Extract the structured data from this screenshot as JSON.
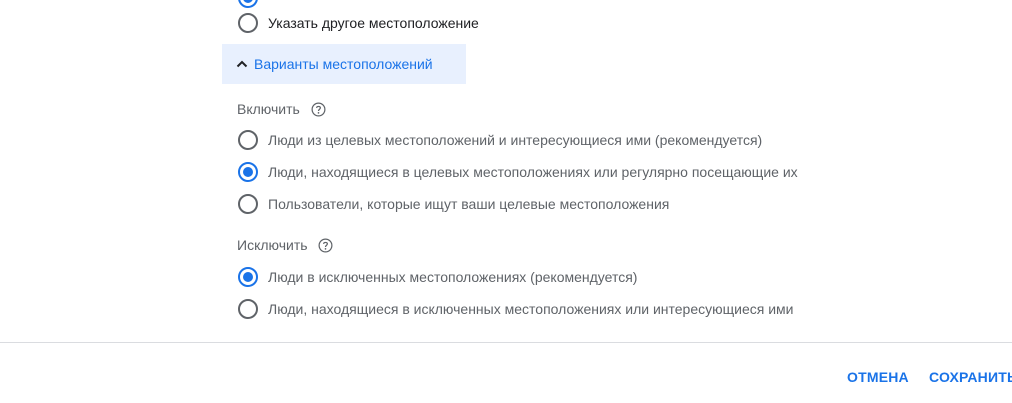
{
  "location_options": {
    "other_location_label": "Указать другое местоположение"
  },
  "panel": {
    "toggle_label": "Варианты местоположений",
    "toggle_icon": "chevron-up-icon"
  },
  "include": {
    "title": "Включить",
    "help_icon": "help-icon",
    "options": [
      {
        "label": "Люди из целевых местоположений и интересующиеся ими (рекомендуется)",
        "checked": false
      },
      {
        "label": "Люди, находящиеся в целевых местоположениях или регулярно посещающие их",
        "checked": true
      },
      {
        "label": "Пользователи, которые ищут ваши целевые местоположения",
        "checked": false
      }
    ]
  },
  "exclude": {
    "title": "Исключить",
    "help_icon": "help-icon",
    "options": [
      {
        "label": "Люди в исключенных местоположениях (рекомендуется)",
        "checked": true
      },
      {
        "label": "Люди, находящиеся в исключенных местоположениях или интересующиеся ими",
        "checked": false
      }
    ]
  },
  "actions": {
    "cancel_label": "ОТМЕНА",
    "save_label": "СОХРАНИТЬ"
  },
  "colors": {
    "accent": "#1a73e8",
    "panel_bg": "#e8f0fe",
    "text_secondary": "#5f6368",
    "divider": "#dadce0"
  }
}
